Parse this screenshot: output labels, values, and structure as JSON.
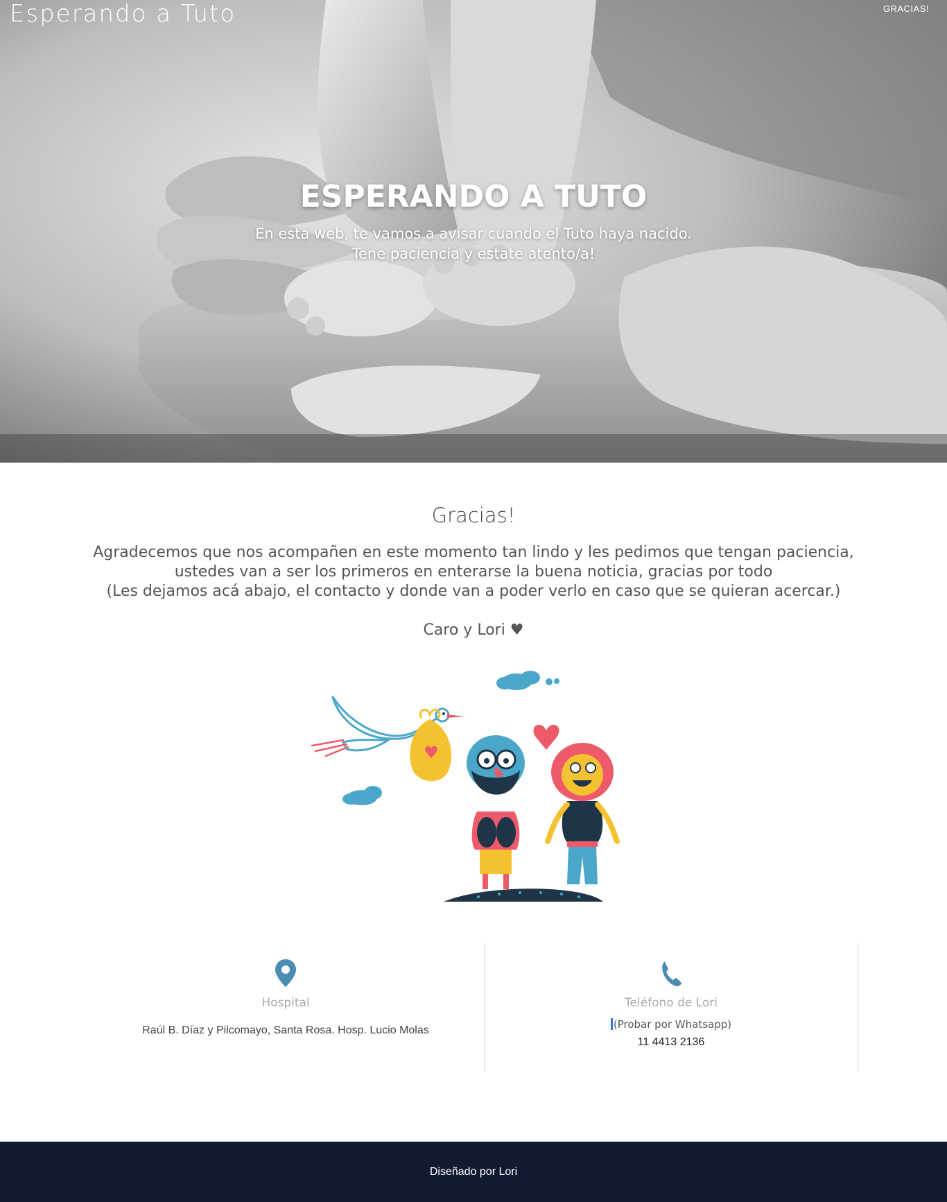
{
  "header": {
    "brand": "Esperando a Tuto",
    "nav": [
      {
        "label": "GRACIAS!"
      }
    ]
  },
  "hero": {
    "title": "ESPERANDO A TUTO",
    "subtitle_line1": "En esta web, te vamos a avisar cuando el Tuto haya nacido.",
    "subtitle_line2": "Tene paciencia y estate atento/a!"
  },
  "thanks": {
    "heading": "Gracias!",
    "line1": "Agradecemos que nos acompañen en este momento tan lindo y les pedimos que tengan paciencia,",
    "line2": "ustedes van a ser los primeros en enterarse la buena noticia, gracias por todo",
    "line3": "(Les dejamos acá abajo, el contacto y donde van a poder verlo en caso que se quieran acercar.)",
    "signature": "Caro y Lori ♥"
  },
  "contact": {
    "hospital": {
      "icon": "map-marker-icon",
      "title": "Hospital",
      "address": "Raúl B. Díaz y Pilcomayo, Santa Rosa. Hosp. Lucio Molas"
    },
    "phone": {
      "icon": "phone-icon",
      "title": "Teléfono de Lori",
      "note": "(Probar por Whatsapp)",
      "number": "11 4413 2136"
    }
  },
  "footer": {
    "text": "Diseñado por Lori"
  },
  "colors": {
    "footer_bg": "#101a30",
    "icon_blue": "#4a8db3",
    "heart_red": "#ee5a6a",
    "bundle_yellow": "#f4c230",
    "stork_blue": "#4aa7c9"
  }
}
